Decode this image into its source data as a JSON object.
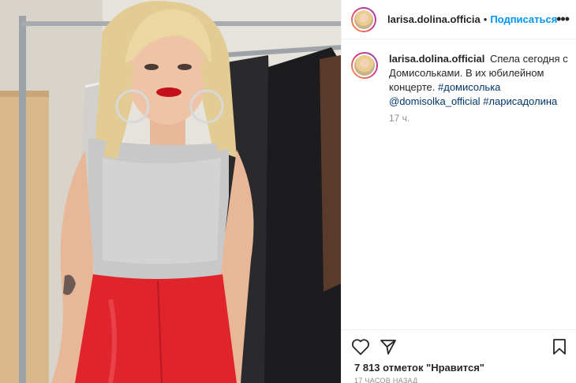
{
  "post": {
    "username": "larisa.dolina.officia",
    "separator": "•",
    "follow_label": "Подписаться",
    "more_label": "•••"
  },
  "caption": {
    "username": "larisa.dolina.official",
    "text_part1": "Спела сегодня с Домисольками. В их юбилейном концерте.",
    "hashtag1": "#домисолька",
    "mention": "@domisolka_official",
    "hashtag2": "#ларисадолина",
    "time": "17 ч."
  },
  "actions": {
    "likes_text": "7 813 отметок \"Нравится\"",
    "posted_ago": "17 часов назад",
    "icons": [
      "heart-icon",
      "share-icon",
      "bookmark-icon"
    ]
  },
  "colors": {
    "accent": "#0095f6",
    "hashtag": "#00376b",
    "muted": "#8e8e8e",
    "top_silver": "#c8c8c8",
    "pants_red": "#e0242c"
  }
}
